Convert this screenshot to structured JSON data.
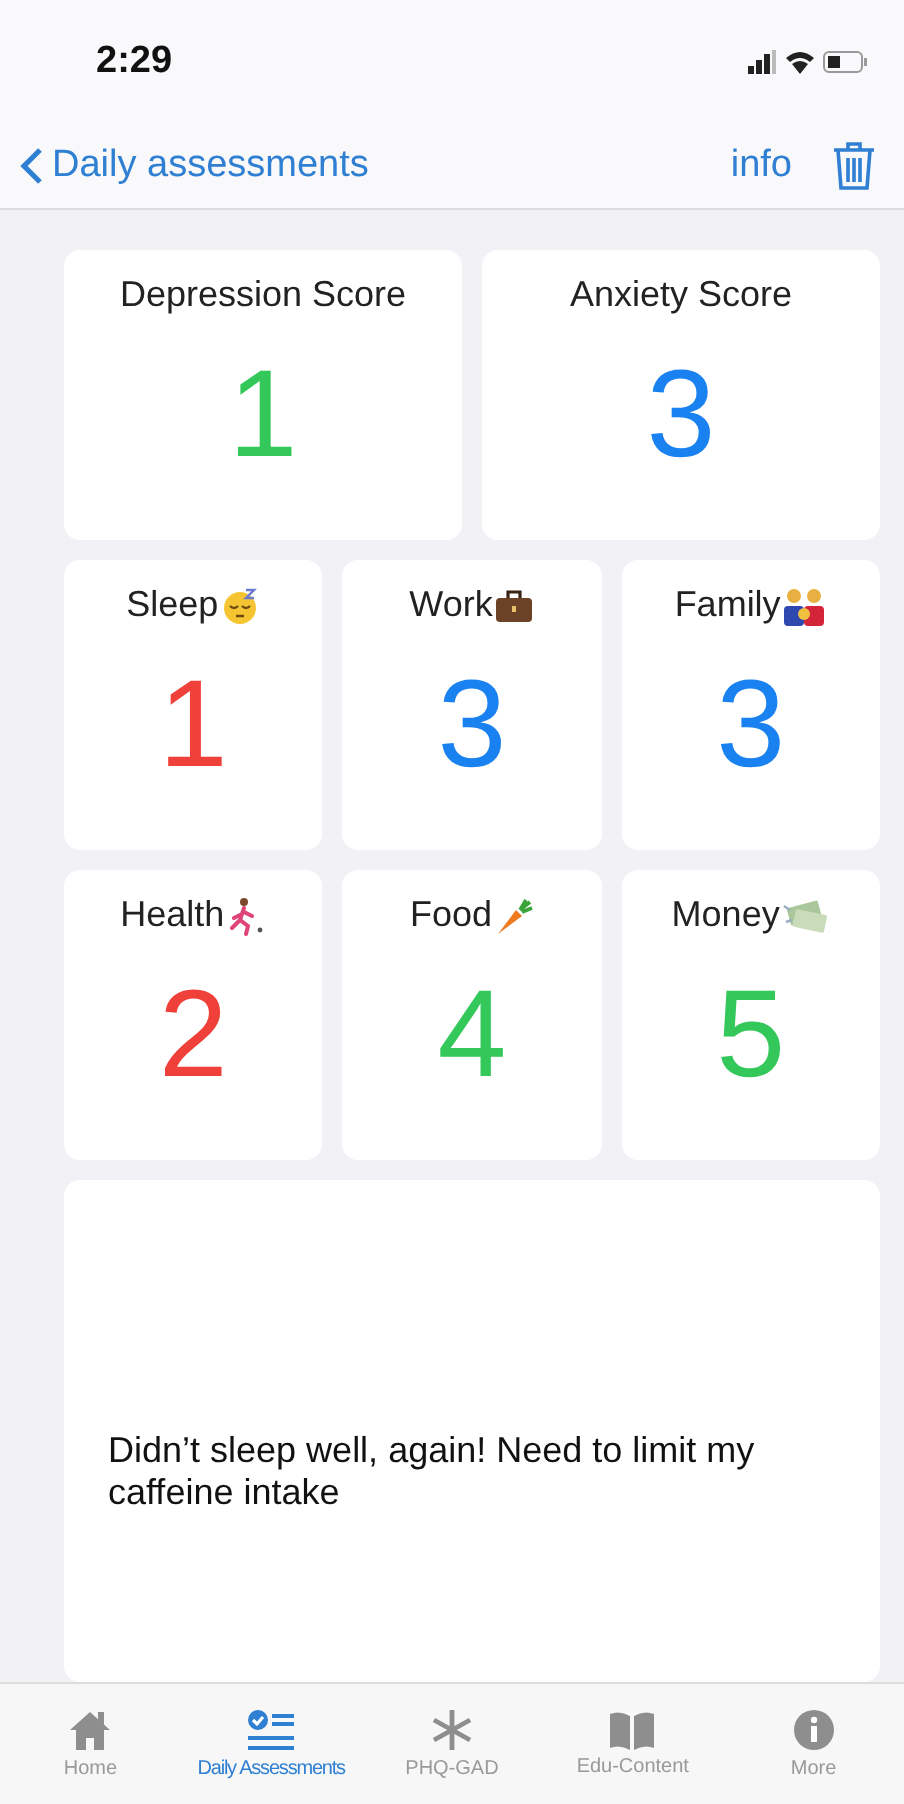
{
  "status_bar": {
    "time": "2:29"
  },
  "nav": {
    "back": "Daily assessments",
    "info": "info"
  },
  "scores": [
    {
      "label": "Depression Score",
      "value": "1",
      "color": "#34c759"
    },
    {
      "label": "Anxiety Score",
      "value": "3",
      "color": "#1a82f0"
    }
  ],
  "categories": [
    {
      "label": "Sleep",
      "value": "1",
      "color": "#f0403a"
    },
    {
      "label": "Work",
      "value": "3",
      "color": "#1a82f0"
    },
    {
      "label": "Family",
      "value": "3",
      "color": "#1a82f0"
    },
    {
      "label": "Health",
      "value": "2",
      "color": "#f0403a"
    },
    {
      "label": "Food",
      "value": "4",
      "color": "#34c759"
    },
    {
      "label": "Money",
      "value": "5",
      "color": "#34c759"
    }
  ],
  "note": "Didn’t sleep well, again! Need to limit my caffeine intake",
  "tabs": [
    {
      "label": "Home",
      "selected": false
    },
    {
      "label": "Daily Assessments",
      "selected": true
    },
    {
      "label": "PHQ-GAD",
      "selected": false
    },
    {
      "label": "Edu-Content",
      "selected": false
    },
    {
      "label": "More",
      "selected": false
    }
  ]
}
